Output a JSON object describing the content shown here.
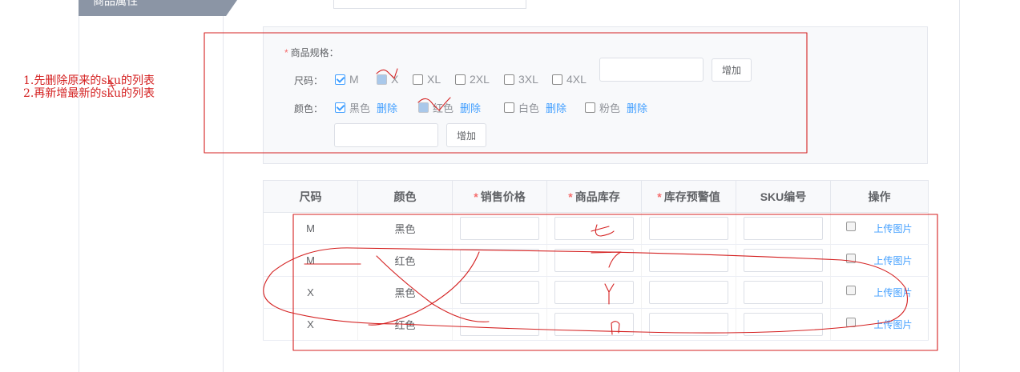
{
  "section": {
    "title": "商品属性"
  },
  "spec": {
    "title": "商品规格：",
    "size_label": "尺码：",
    "color_label": "颜色：",
    "sizes": [
      {
        "label": "M",
        "checked": true
      },
      {
        "label": "X",
        "checked": true
      },
      {
        "label": "XL",
        "checked": false
      },
      {
        "label": "2XL",
        "checked": false
      },
      {
        "label": "3XL",
        "checked": false
      },
      {
        "label": "4XL",
        "checked": false
      }
    ],
    "colors": [
      {
        "label": "黑色",
        "checked": true,
        "delete": "删除"
      },
      {
        "label": "红色",
        "checked": true,
        "delete": "删除"
      },
      {
        "label": "白色",
        "checked": false,
        "delete": "删除"
      },
      {
        "label": "粉色",
        "checked": false,
        "delete": "删除"
      }
    ],
    "size_add_button": "增加",
    "color_add_button": "增加"
  },
  "table": {
    "headers": [
      {
        "label": "尺码",
        "required": false
      },
      {
        "label": "颜色",
        "required": false
      },
      {
        "label": "销售价格",
        "required": true
      },
      {
        "label": "商品库存",
        "required": true
      },
      {
        "label": "库存预警值",
        "required": true
      },
      {
        "label": "SKU编号",
        "required": false
      },
      {
        "label": "操作",
        "required": false
      }
    ],
    "rows": [
      {
        "size": "M",
        "color": "黑色",
        "upload": "上传图片"
      },
      {
        "size": "M",
        "color": "红色",
        "upload": "上传图片"
      },
      {
        "size": "X",
        "color": "黑色",
        "upload": "上传图片"
      },
      {
        "size": "X",
        "color": "红色",
        "upload": "上传图片"
      }
    ]
  },
  "annotations": {
    "note_1": "1.先删除原来的sku的列表",
    "note_2": "2.再新增最新的sku的列表",
    "color": "#d42020"
  },
  "colors": {
    "link": "#409eff",
    "required": "#f56c6c",
    "checked": "#409eff"
  }
}
